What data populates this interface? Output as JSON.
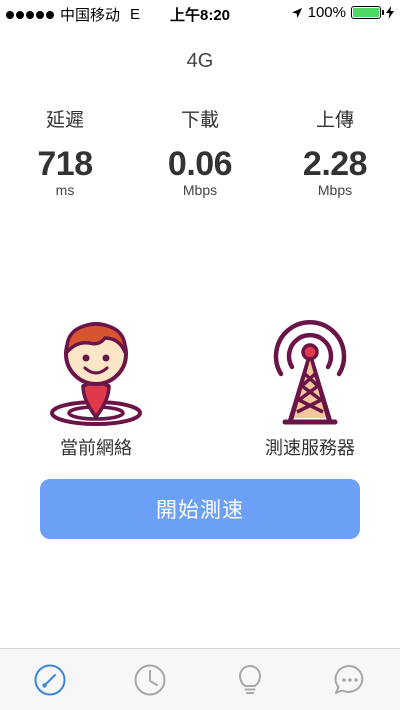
{
  "status_bar": {
    "carrier": "中国移动",
    "network": "E",
    "time": "上午8:20",
    "battery_percent": "100%",
    "battery_level": 1.0
  },
  "network_type": "4G",
  "metrics": [
    {
      "label": "延遲",
      "value": "718",
      "unit": "ms"
    },
    {
      "label": "下載",
      "value": "0.06",
      "unit": "Mbps"
    },
    {
      "label": "上傳",
      "value": "2.28",
      "unit": "Mbps"
    }
  ],
  "current_network_label": "當前網絡",
  "test_server_label": "測速服務器",
  "start_button_label": "開始測速",
  "tabs": [
    {
      "icon": "speedometer-icon",
      "active": true
    },
    {
      "icon": "clock-icon",
      "active": false
    },
    {
      "icon": "lightbulb-icon",
      "active": false
    },
    {
      "icon": "chat-bubble-icon",
      "active": false
    }
  ],
  "colors": {
    "accent": "#6ba0f6",
    "tab_active": "#3d87d8",
    "tab_inactive": "#a8a8a8",
    "illustration_stroke": "#6b1447",
    "illustration_red": "#e0394b",
    "battery": "#4cd964"
  }
}
